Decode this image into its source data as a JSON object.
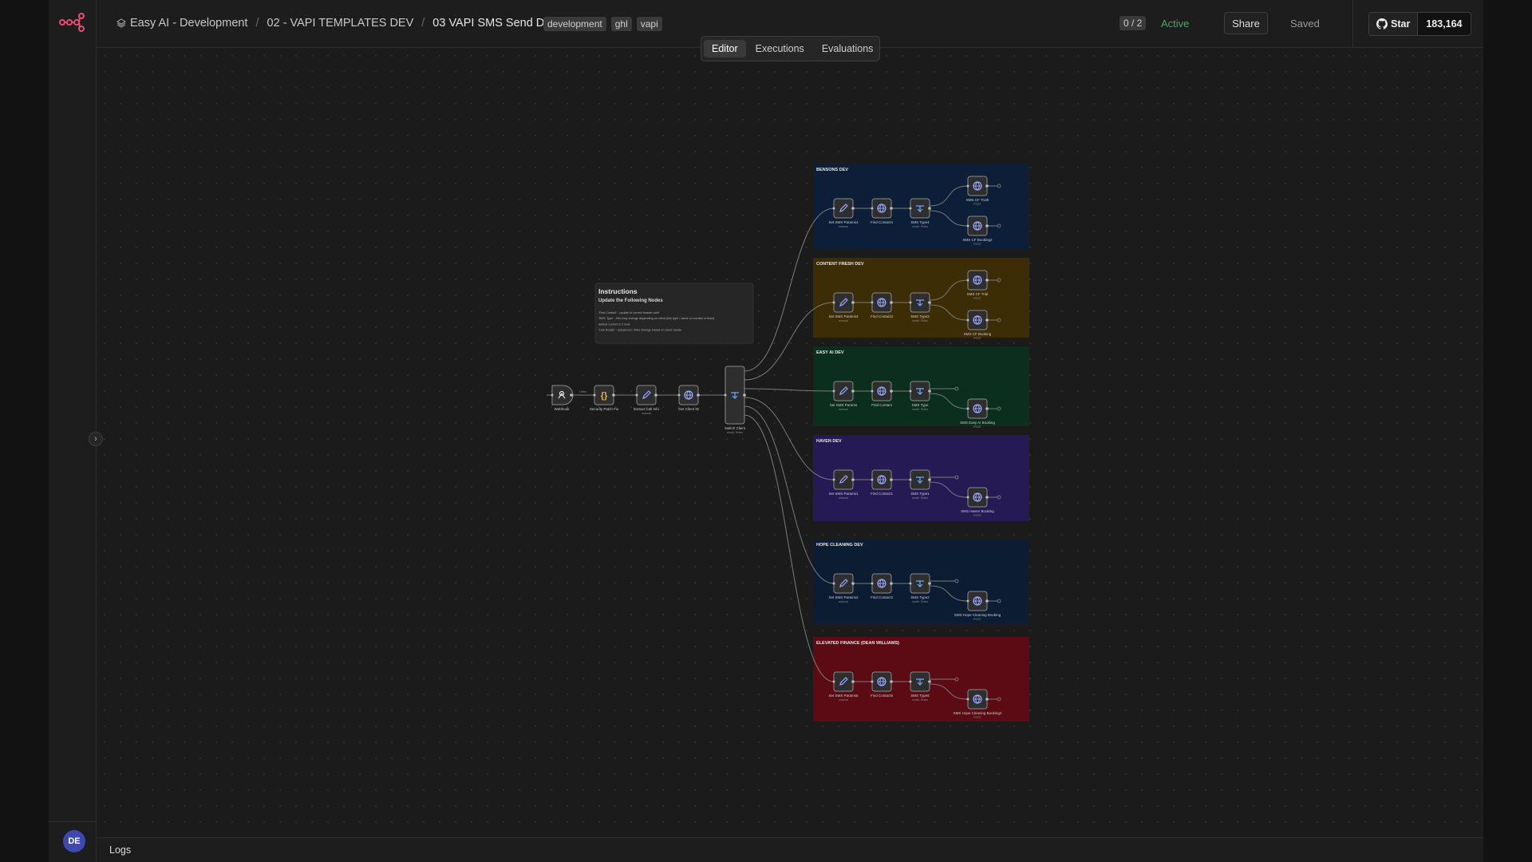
{
  "app": {
    "breadcrumbs": [
      "Easy AI - Development",
      "02 - VAPI TEMPLATES DEV",
      "03 VAPI SMS Send Dev"
    ],
    "tags": [
      "development",
      "ghl",
      "vapi"
    ],
    "counter": "0 / 2",
    "status": "Active",
    "share_label": "Share",
    "saved_label": "Saved",
    "github": {
      "star_label": "Star",
      "count": "183,164"
    },
    "user_initials": "DE",
    "logs_label": "Logs",
    "collapse_glyph": "›"
  },
  "tabs": [
    "Editor",
    "Executions",
    "Evaluations"
  ],
  "colors": {
    "accent": "#ea4b71",
    "active": "#49a85f",
    "group_bensons": "#0c1e38",
    "group_content_fresh": "#3d2d06",
    "group_easy_ai": "#0b2e1e",
    "group_haven": "#261a55",
    "group_hope_cleaning": "#0c1c33",
    "group_elevated": "#5c0a14"
  },
  "sticky": {
    "title": "Instructions",
    "subtitle": "Update the Following Nodes",
    "lines": [
      "'Find Contact' - update to correct header auth",
      "'SMS Type' - this may change depending on client (link type / name or number of links)",
      "default current is 2 max",
      "'Link Router' - actual text / links change based on client needs"
    ]
  },
  "main_nodes": [
    {
      "label": "Webhook",
      "icon": "webhook-icon"
    },
    {
      "label": "Security Patch Fix",
      "icon": "code-icon"
    },
    {
      "label": "Extract Call Info",
      "icon": "edit-icon",
      "sub": "manual"
    },
    {
      "label": "Get Client ID",
      "icon": "globe-icon"
    },
    {
      "label": "Switch Client",
      "icon": "switch-icon",
      "sub": "mode: Rules"
    }
  ],
  "groups": [
    {
      "title": "BENSONS DEV",
      "color": "#0c1e38",
      "nodes": [
        "Set SMS Params4",
        "Find Contact4",
        "SMS Type4"
      ],
      "outs": [
        "SMS CF Truth",
        "SMS CF Booking2"
      ]
    },
    {
      "title": "CONTENT FRESH DEV",
      "color": "#3d2d06",
      "nodes": [
        "Set SMS Params3",
        "Find Contact3",
        "SMS Type3"
      ],
      "outs": [
        "SMS CF Trial",
        "SMS CF Booking"
      ]
    },
    {
      "title": "EASY AI DEV",
      "color": "#0b2e1e",
      "nodes": [
        "Set SMS Params",
        "Find Contact",
        "SMS Type"
      ],
      "outs": [
        "SMS Easy AI Booking"
      ]
    },
    {
      "title": "HAVEN DEV",
      "color": "#261a55",
      "nodes": [
        "Set SMS Params1",
        "Find Contact1",
        "SMS Type1"
      ],
      "outs": [
        "SMS Haven Booking"
      ]
    },
    {
      "title": "HOPE CLEANING DEV",
      "color": "#0c1c33",
      "nodes": [
        "Set SMS Params2",
        "Find Contact2",
        "SMS Type2"
      ],
      "outs": [
        "SMS Hope Cleaning Booking"
      ]
    },
    {
      "title": "ELEVATED FINANCE (DEAN WILLIAMS)",
      "color": "#5c0a14",
      "nodes": [
        "Set SMS Params5",
        "Find Contact5",
        "SMS Type5"
      ],
      "outs": [
        "SMS Hope Cleaning Booking2"
      ]
    }
  ]
}
